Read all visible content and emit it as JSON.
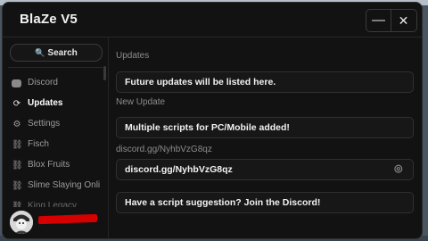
{
  "window": {
    "title": "BlaZe V5",
    "minimize_glyph": "—",
    "close_glyph": "✕"
  },
  "sidebar": {
    "search_label": "Search",
    "items": [
      {
        "label": "Discord",
        "icon": "discord-icon",
        "active": false
      },
      {
        "label": "Updates",
        "icon": "updates-icon",
        "active": true
      },
      {
        "label": "Settings",
        "icon": "settings-icon",
        "active": false
      },
      {
        "label": "Fisch",
        "icon": "link-icon",
        "active": false
      },
      {
        "label": "Blox Fruits",
        "icon": "link-icon",
        "active": false
      },
      {
        "label": "Slime Slaying Onli",
        "icon": "link-icon",
        "active": false
      },
      {
        "label": "King Legacy",
        "icon": "link-icon",
        "active": false
      }
    ]
  },
  "content": {
    "sections": [
      {
        "heading": "Updates",
        "card": "Future updates will be listed here."
      },
      {
        "heading": "New Update",
        "card": "Multiple scripts for PC/Mobile added!"
      },
      {
        "heading": "discord.gg/NyhbVzG8qz",
        "card": "discord.gg/NyhbVzG8qz"
      }
    ],
    "suggestion_button": "Have a script suggestion? Join the Discord!"
  },
  "colors": {
    "background": "#121212",
    "border": "#303030",
    "text": "#f2f2f2",
    "muted": "#8c8c8c",
    "redaction": "#d50000"
  }
}
